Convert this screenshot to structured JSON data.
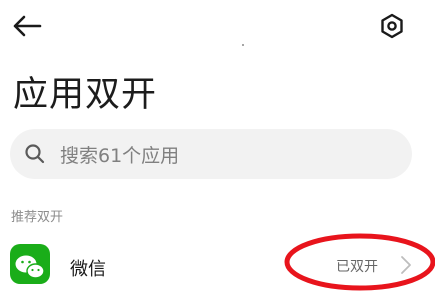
{
  "header": {
    "back_icon": "arrow-left-icon",
    "settings_icon": "hexagon-settings-icon"
  },
  "page_title": "应用双开",
  "search": {
    "placeholder": "搜索61个应用",
    "icon": "search-icon"
  },
  "section": {
    "label": "推荐双开"
  },
  "apps": [
    {
      "name": "微信",
      "icon": "wechat-icon",
      "status": "已双开",
      "icon_color": "#1aad19"
    }
  ],
  "colors": {
    "annotation_circle": "#e8141c",
    "search_background": "#f2f2f2"
  }
}
